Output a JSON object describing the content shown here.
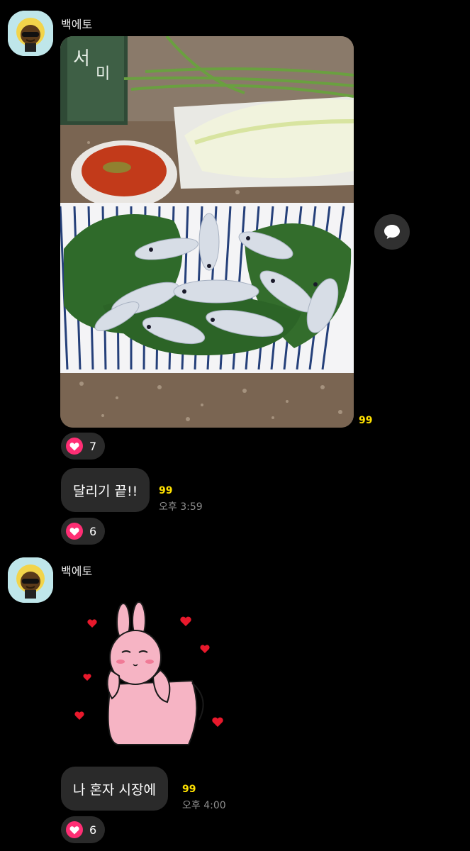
{
  "messages": [
    {
      "sender": "백에토",
      "photo": {
        "alt": "",
        "unread": "99"
      },
      "photo_reaction": {
        "icon": "heart-icon",
        "count": "7"
      },
      "text": "달리기 끝!!",
      "text_unread": "99",
      "time": "오후 3:59",
      "text_reaction": {
        "icon": "heart-icon",
        "count": "6"
      }
    },
    {
      "sender": "백에토",
      "sticker": {
        "name": "pink-bunny-sticker"
      },
      "text": "나 혼자 시장에",
      "text_unread": "99",
      "time": "오후 4:00",
      "text_reaction": {
        "icon": "heart-icon",
        "count": "6"
      }
    }
  ],
  "colors": {
    "background": "#000000",
    "bubble": "#2a2a2a",
    "unread": "#ffe100",
    "heart": "#ff2e74",
    "avatar_bg": "#bfe6ea"
  }
}
